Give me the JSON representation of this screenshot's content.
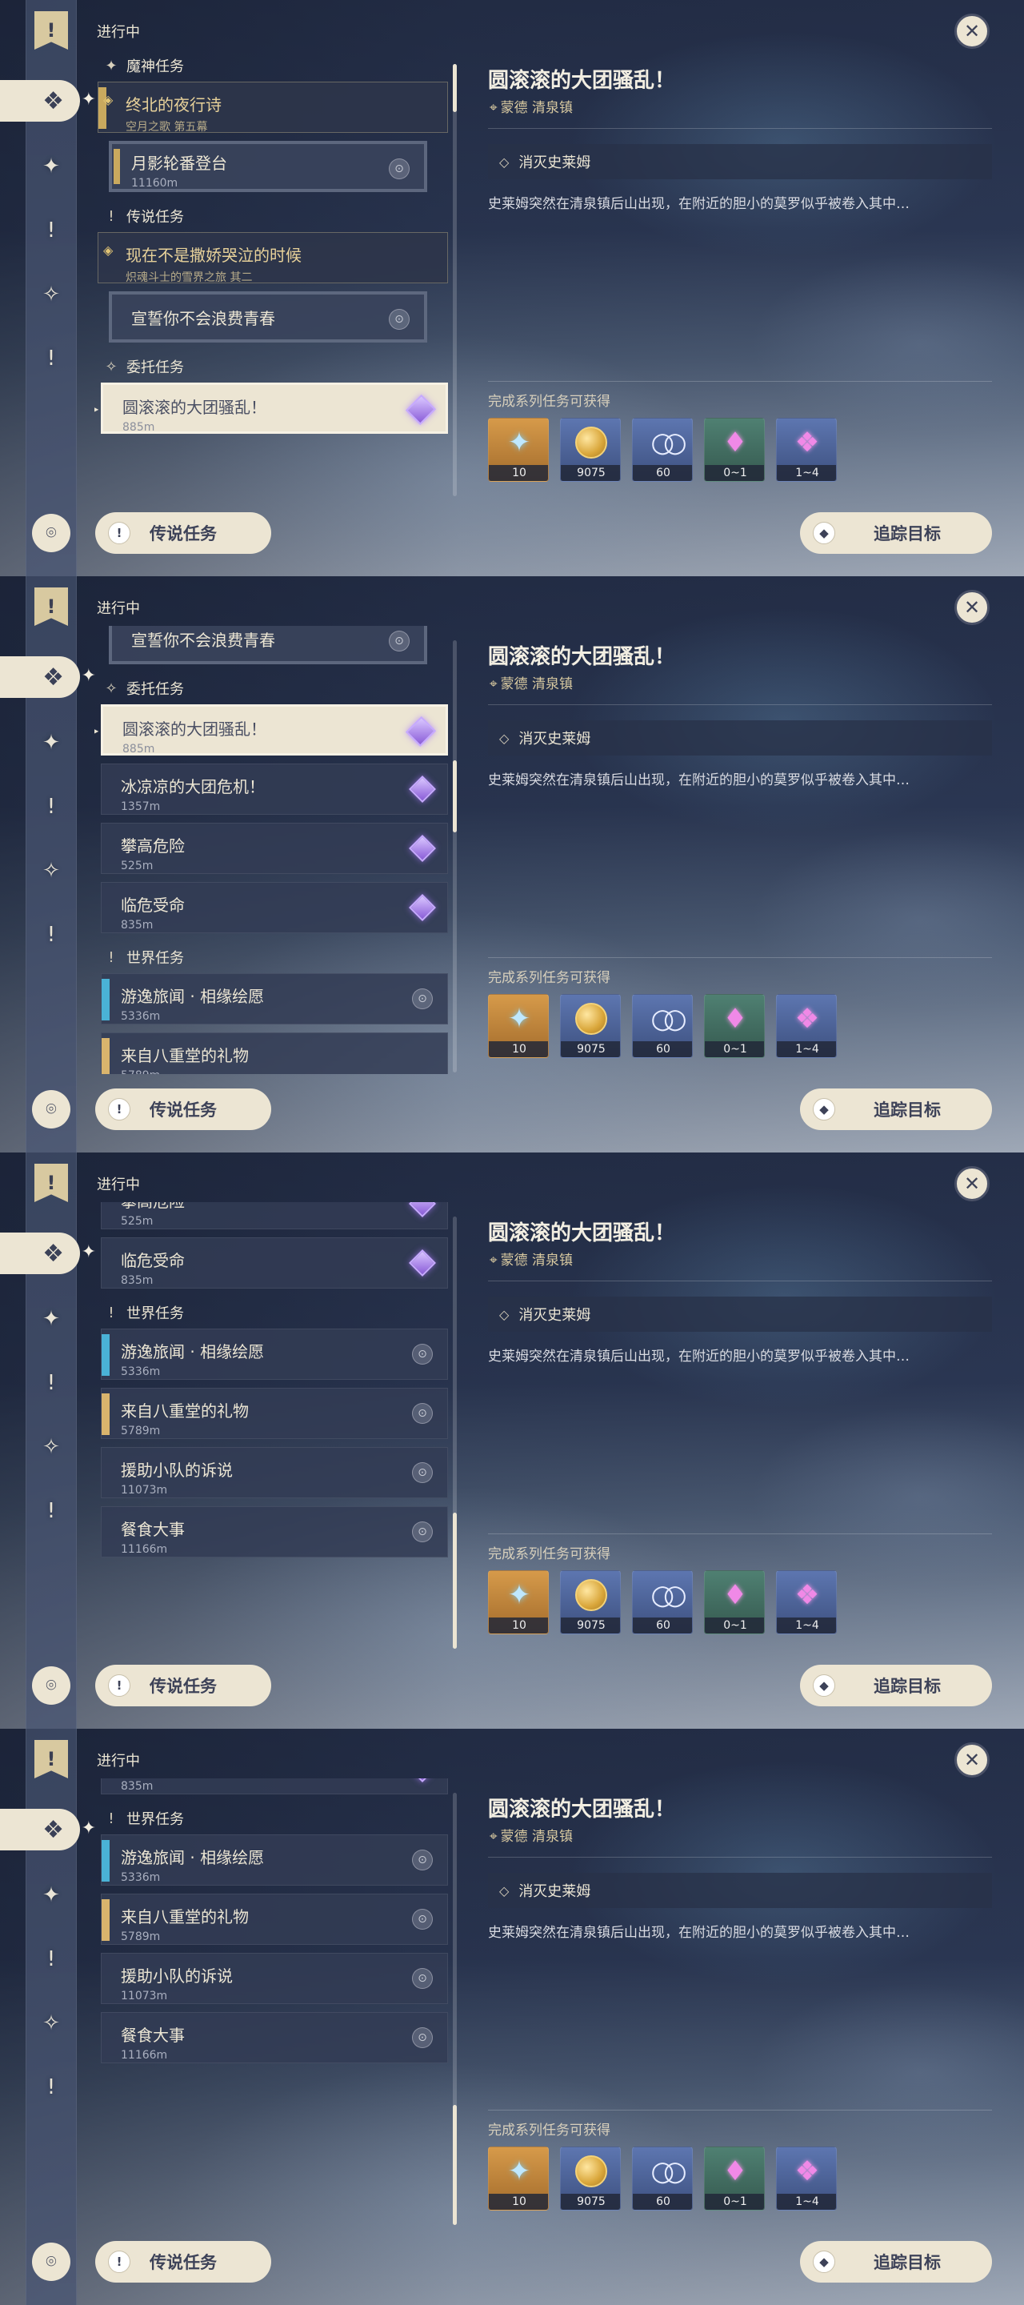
{
  "header": {
    "title": "进行中",
    "close_glyph": "✕"
  },
  "rail": {
    "tabs": [
      {
        "name": "quest-banner-icon",
        "glyph": "!"
      },
      {
        "name": "all-quests-icon",
        "glyph": "❖"
      },
      {
        "name": "archon-quests-icon",
        "glyph": "✦"
      },
      {
        "name": "story-quests-icon",
        "glyph": "!"
      },
      {
        "name": "commission-quests-icon",
        "glyph": "✧"
      },
      {
        "name": "world-quests-icon",
        "glyph": "!"
      }
    ]
  },
  "sections": {
    "archon": "魔神任务",
    "legend": "传说任务",
    "commission": "委托任务",
    "world": "世界任务"
  },
  "quests": {
    "archon_chapter": {
      "title": "终北的夜行诗",
      "subtitle": "空月之歌 第五幕"
    },
    "moon_shadow": {
      "name": "月影轮番登台",
      "dist": "11160m"
    },
    "legend_chapter": {
      "title": "现在不是撒娇哭泣的时候",
      "subtitle": "炽魂斗士的雪界之旅 其二"
    },
    "vow": {
      "name": "宣誓你不会浪费青春"
    },
    "slime": {
      "name": "圆滚滚的大团骚乱！",
      "dist": "885m"
    },
    "ice": {
      "name": "冰凉凉的大团危机！",
      "dist": "1357m"
    },
    "climb": {
      "name": "攀高危险",
      "dist": "525m"
    },
    "danger": {
      "name": "临危受命",
      "dist": "835m"
    },
    "wander": {
      "name": "游逸旅闻 · 相缘绘愿",
      "dist": "5336m"
    },
    "gift": {
      "name": "来自八重堂的礼物",
      "dist": "5789m"
    },
    "squad": {
      "name": "援助小队的诉说",
      "dist": "11073m"
    },
    "food": {
      "name": "餐食大事",
      "dist": "11166m"
    }
  },
  "detail": {
    "title": "圆滚滚的大团骚乱！",
    "location": "蒙德 清泉镇",
    "objective": "消灭史莱姆",
    "description": "史莱姆突然在清泉镇后山出现，在附近的胆小的莫罗似乎被卷入其中…",
    "rewards_label": "完成系列任务可获得",
    "rewards": [
      {
        "name": "adventure-exp",
        "count": "10"
      },
      {
        "name": "mora",
        "count": "9075"
      },
      {
        "name": "companionship-exp",
        "count": "60"
      },
      {
        "name": "crystal-chunk",
        "count": "0~1"
      },
      {
        "name": "primogem",
        "count": "1~4"
      }
    ]
  },
  "buttons": {
    "legend": "传说任务",
    "track": "追踪目标"
  },
  "colors": {
    "accent_cream": "#ece5d3",
    "gold_text": "#e8d29a",
    "purple_gem": "#8a5cd8"
  }
}
